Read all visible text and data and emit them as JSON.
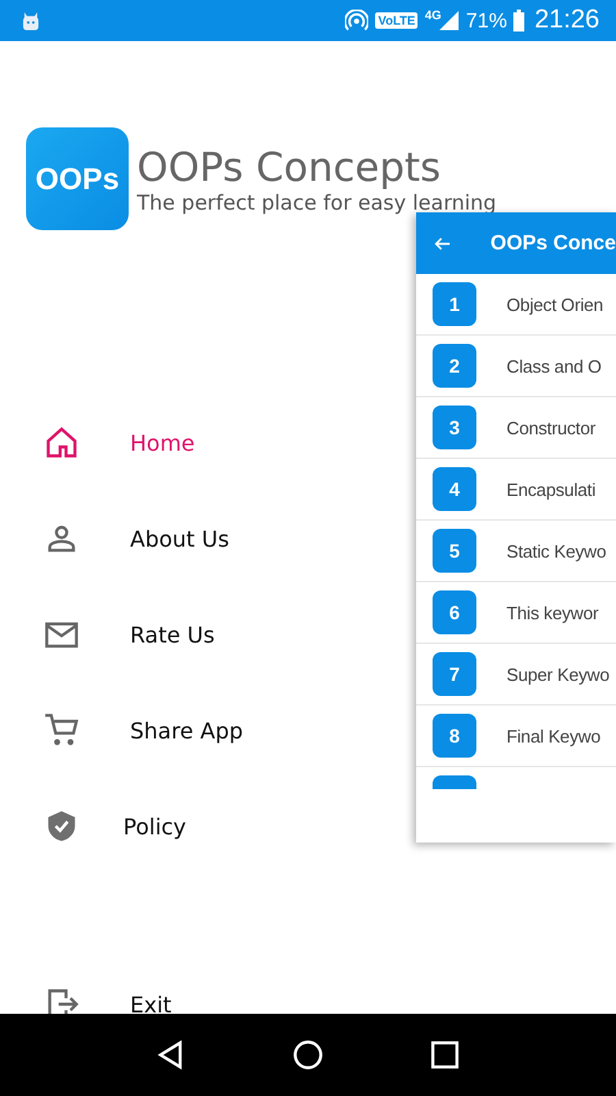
{
  "status_bar": {
    "volte": "VoLTE",
    "network": "4G",
    "battery": "71%",
    "time": "21:26"
  },
  "header": {
    "logo": "OOPs",
    "title": "OOPs Concepts",
    "subtitle": "The perfect place for easy learning"
  },
  "menu": [
    {
      "kind": "home",
      "label": "Home",
      "selected": true
    },
    {
      "kind": "person",
      "label": "About Us",
      "selected": false
    },
    {
      "kind": "mail",
      "label": "Rate Us",
      "selected": false
    },
    {
      "kind": "cart",
      "label": "Share App",
      "selected": false
    },
    {
      "kind": "shield",
      "label": "Policy",
      "selected": false
    },
    {
      "kind": "exit",
      "label": "Exit",
      "selected": false
    }
  ],
  "preview": {
    "title": "OOPs Conce",
    "items": [
      {
        "number": "1",
        "label": "Object Orien"
      },
      {
        "number": "2",
        "label": "Class and O"
      },
      {
        "number": "3",
        "label": "Constructor"
      },
      {
        "number": "4",
        "label": "Encapsulati"
      },
      {
        "number": "5",
        "label": "Static Keywo"
      },
      {
        "number": "6",
        "label": "This keywor"
      },
      {
        "number": "7",
        "label": "Super Keywo"
      },
      {
        "number": "8",
        "label": "Final Keywo"
      }
    ]
  }
}
